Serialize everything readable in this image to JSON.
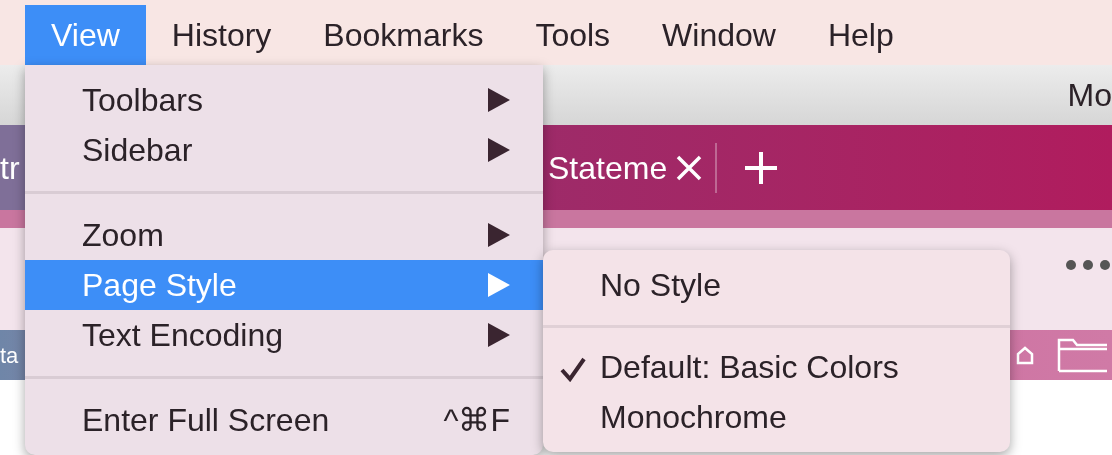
{
  "menu_bar": {
    "items": [
      {
        "label": "View",
        "selected": true
      },
      {
        "label": "History",
        "selected": false
      },
      {
        "label": "Bookmarks",
        "selected": false
      },
      {
        "label": "Tools",
        "selected": false
      },
      {
        "label": "Window",
        "selected": false
      },
      {
        "label": "Help",
        "selected": false
      }
    ]
  },
  "browser_window": {
    "title": "Mo",
    "tabs": [
      {
        "label": "tr",
        "selected": false
      },
      {
        "label": "Stateme",
        "selected": true
      }
    ],
    "bookmarks_bar_text": "ta"
  },
  "view_menu": {
    "items": [
      {
        "kind": "item",
        "label": "Toolbars",
        "submenu": true,
        "selected": false
      },
      {
        "kind": "item",
        "label": "Sidebar",
        "submenu": true,
        "selected": false
      },
      {
        "kind": "separator"
      },
      {
        "kind": "item",
        "label": "Zoom",
        "submenu": true,
        "selected": false
      },
      {
        "kind": "item",
        "label": "Page Style",
        "submenu": true,
        "selected": true
      },
      {
        "kind": "item",
        "label": "Text Encoding",
        "submenu": true,
        "selected": false
      },
      {
        "kind": "separator"
      },
      {
        "kind": "item",
        "label": "Enter Full Screen",
        "shortcut": "^⌘F",
        "submenu": false,
        "selected": false
      }
    ]
  },
  "page_style_submenu": {
    "items": [
      {
        "kind": "item",
        "label": "No Style",
        "checked": false
      },
      {
        "kind": "separator"
      },
      {
        "kind": "item",
        "label": "Default: Basic Colors",
        "checked": true
      },
      {
        "kind": "item",
        "label": "Monochrome",
        "checked": false
      }
    ]
  }
}
